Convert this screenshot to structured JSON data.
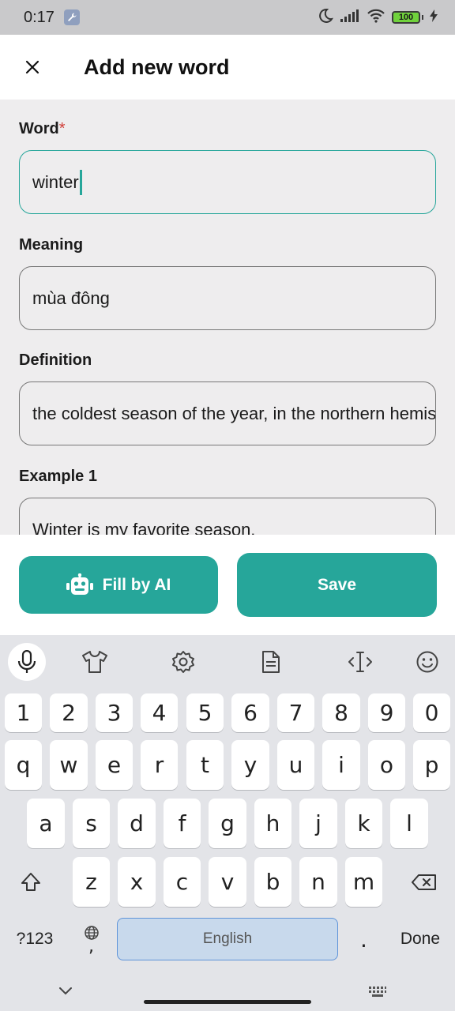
{
  "status_bar": {
    "time": "0:17",
    "battery": "100"
  },
  "header": {
    "title": "Add new word"
  },
  "form": {
    "word": {
      "label": "Word",
      "required_mark": "*",
      "value": "winter"
    },
    "meaning": {
      "label": "Meaning",
      "value": "mùa đông"
    },
    "definition": {
      "label": "Definition",
      "value": "the coldest season of the year, in the northern hemisphere"
    },
    "example1": {
      "label": "Example 1",
      "value": "Winter is my favorite season."
    }
  },
  "actions": {
    "fill_ai_label": "Fill by AI",
    "save_label": "Save"
  },
  "keyboard": {
    "number_row": [
      "1",
      "2",
      "3",
      "4",
      "5",
      "6",
      "7",
      "8",
      "9",
      "0"
    ],
    "row1": [
      "q",
      "w",
      "e",
      "r",
      "t",
      "y",
      "u",
      "i",
      "o",
      "p"
    ],
    "row2": [
      "a",
      "s",
      "d",
      "f",
      "g",
      "h",
      "j",
      "k",
      "l"
    ],
    "row3": [
      "z",
      "x",
      "c",
      "v",
      "b",
      "n",
      "m"
    ],
    "symbols_key": "?123",
    "comma_key": ",",
    "space_label": "English",
    "period_key": ".",
    "done_key": "Done"
  },
  "colors": {
    "accent": "#26a69a",
    "required": "#d03c36"
  }
}
